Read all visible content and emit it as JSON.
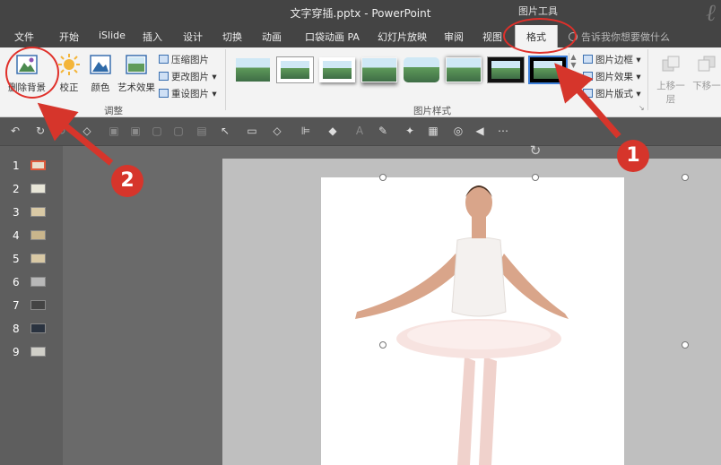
{
  "titlebar": {
    "title": "文字穿插.pptx  -  PowerPoint",
    "context_label": "图片工具"
  },
  "tabs": [
    "文件",
    "开始",
    "iSlide",
    "插入",
    "设计",
    "切换",
    "动画",
    "口袋动画 PA",
    "幻灯片放映",
    "审阅",
    "视图",
    "格式"
  ],
  "tell_me": "告诉我你想要做什么",
  "ribbon": {
    "remove_bg": "删除背景",
    "corrections": "校正",
    "color": "颜色",
    "artistic": "艺术效果",
    "compress": "压缩图片",
    "change": "更改图片",
    "reset": "重设图片",
    "adjust_group": "调整",
    "styles_group": "图片样式",
    "border": "图片边框",
    "effects": "图片效果",
    "layout": "图片版式",
    "bring_forward": "上移一层",
    "send_backward": "下移一"
  },
  "slides": [
    "1",
    "2",
    "3",
    "4",
    "5",
    "6",
    "7",
    "8",
    "9"
  ],
  "annotations": {
    "badge1": "1",
    "badge2": "2"
  },
  "colors": {
    "annotation": "#d6352b",
    "ribbon_bg": "#f3f3f3",
    "titlebar": "#444444"
  }
}
